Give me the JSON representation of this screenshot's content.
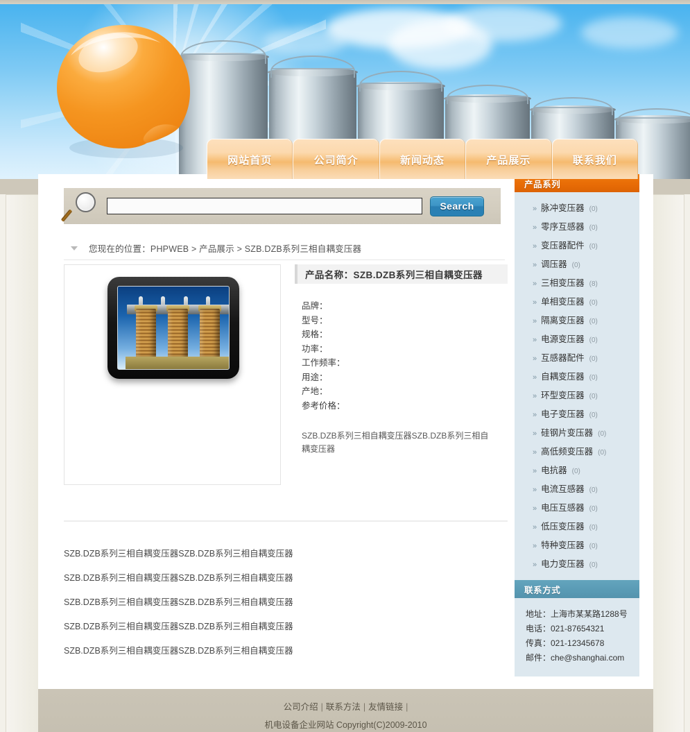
{
  "site": {
    "logo_icon": "orange-sticker-logo",
    "banner_icon": "industrial-silos-banner"
  },
  "nav": {
    "items": [
      {
        "label": "网站首页",
        "name": "nav-home"
      },
      {
        "label": "公司简介",
        "name": "nav-about"
      },
      {
        "label": "新闻动态",
        "name": "nav-news"
      },
      {
        "label": "产品展示",
        "name": "nav-products"
      },
      {
        "label": "联系我们",
        "name": "nav-contact"
      }
    ]
  },
  "search": {
    "icon": "magnifier-icon",
    "value": "",
    "placeholder": "",
    "button_label": "Search"
  },
  "breadcrumb": {
    "marker_icon": "triangle-down-icon",
    "text": "您现在的位置：PHPWEB > 产品展示  > SZB.DZB系列三相自耦变压器"
  },
  "product": {
    "image_icon": "three-phase-transformer-photo",
    "title_label": "产品名称：",
    "title_value": "SZB.DZB系列三相自耦变压器",
    "specs": [
      "品牌：",
      "型号：",
      "规格：",
      "功率：",
      "工作频率：",
      "用途：",
      "产地：",
      "参考价格："
    ],
    "description": "SZB.DZB系列三相自耦变压器SZB.DZB系列三相自耦变压器"
  },
  "related": {
    "items": [
      "SZB.DZB系列三相自耦变压器SZB.DZB系列三相自耦变压器",
      "SZB.DZB系列三相自耦变压器SZB.DZB系列三相自耦变压器",
      "SZB.DZB系列三相自耦变压器SZB.DZB系列三相自耦变压器",
      "SZB.DZB系列三相自耦变压器SZB.DZB系列三相自耦变压器",
      "SZB.DZB系列三相自耦变压器SZB.DZB系列三相自耦变压器"
    ]
  },
  "sidebar": {
    "categories_title": "产品系列",
    "categories": [
      {
        "label": "脉冲变压器",
        "count": "(0)"
      },
      {
        "label": "零序互感器",
        "count": "(0)"
      },
      {
        "label": "变压器配件",
        "count": "(0)"
      },
      {
        "label": "调压器",
        "count": "(0)"
      },
      {
        "label": "三相变压器",
        "count": "(8)"
      },
      {
        "label": "单相变压器",
        "count": "(0)"
      },
      {
        "label": "隔离变压器",
        "count": "(0)"
      },
      {
        "label": "电源变压器",
        "count": "(0)"
      },
      {
        "label": "互感器配件",
        "count": "(0)"
      },
      {
        "label": "自耦变压器",
        "count": "(0)"
      },
      {
        "label": "环型变压器",
        "count": "(0)"
      },
      {
        "label": "电子变压器",
        "count": "(0)"
      },
      {
        "label": "硅钢片变压器",
        "count": "(0)"
      },
      {
        "label": "高低频变压器",
        "count": "(0)"
      },
      {
        "label": "电抗器",
        "count": "(0)"
      },
      {
        "label": "电流互感器",
        "count": "(0)"
      },
      {
        "label": "电压互感器",
        "count": "(0)"
      },
      {
        "label": "低压变压器",
        "count": "(0)"
      },
      {
        "label": "特种变压器",
        "count": "(0)"
      },
      {
        "label": "电力变压器",
        "count": "(0)"
      }
    ],
    "contact_title": "联系方式",
    "contact_lines": [
      "地址：上海市某某路1288号",
      "电话：021-87654321",
      "传真：021-12345678",
      "邮件：che@shanghai.com"
    ]
  },
  "footer": {
    "links": [
      "公司介绍",
      "联系方法",
      "友情链接"
    ],
    "separator": "|",
    "copyright": "机电设备企业网站  Copyright(C)2009-2010"
  },
  "colors": {
    "nav_orange": "#f5ba6f",
    "sidebar_header_orange": "#e86c06",
    "sidebar_header_teal": "#5a9bb5",
    "sidebar_body_blue": "#dde8ef",
    "search_button_blue": "#2a7fb3",
    "footer_beige": "#c6c0b1",
    "search_bar_beige": "#d4cec0"
  }
}
